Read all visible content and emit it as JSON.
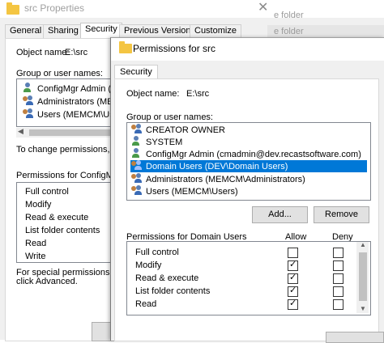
{
  "background_window": {
    "title": "src Properties",
    "tabs": [
      "General",
      "Sharing",
      "Security",
      "Previous Versions",
      "Customize"
    ],
    "active_tab": "Security",
    "object_name_label": "Object name:",
    "object_name_value": "E:\\src",
    "group_label": "Group or user names:",
    "users": [
      "ConfigMgr Admin (cm",
      "Administrators (MEMC",
      "Users (MEMCM\\Users"
    ],
    "change_text": "To change permissions, cl",
    "permissions_label": "Permissions for ConfigMgr",
    "permissions": [
      "Full control",
      "Modify",
      "Read & execute",
      "List folder contents",
      "Read",
      "Write"
    ],
    "special_line1": "For special permissions or",
    "special_line2": "click Advanced.",
    "right_strip_row1": "e folder",
    "right_strip_row2": "e folder"
  },
  "dialog": {
    "title": "Permissions for src",
    "tab": "Security",
    "object_name_label": "Object name:",
    "object_name_value": "E:\\src",
    "group_label": "Group or user names:",
    "users": [
      {
        "name": "CREATOR OWNER",
        "icon": "group-icon",
        "selected": false
      },
      {
        "name": "SYSTEM",
        "icon": "user-icon",
        "selected": false
      },
      {
        "name": "ConfigMgr Admin (cmadmin@dev.recastsoftware.com)",
        "icon": "user-icon",
        "selected": false
      },
      {
        "name": "Domain Users (DEV\\Domain Users)",
        "icon": "group-icon",
        "selected": true
      },
      {
        "name": "Administrators (MEMCM\\Administrators)",
        "icon": "group-icon",
        "selected": false
      },
      {
        "name": "Users (MEMCM\\Users)",
        "icon": "group-icon",
        "selected": false
      }
    ],
    "add_button": "Add...",
    "remove_button": "Remove",
    "permissions_label": "Permissions for Domain Users",
    "allow_label": "Allow",
    "deny_label": "Deny",
    "permissions": [
      {
        "name": "Full control",
        "allow": false,
        "deny": false
      },
      {
        "name": "Modify",
        "allow": true,
        "deny": false
      },
      {
        "name": "Read & execute",
        "allow": true,
        "deny": false
      },
      {
        "name": "List folder contents",
        "allow": true,
        "deny": false
      },
      {
        "name": "Read",
        "allow": true,
        "deny": false
      }
    ],
    "selection_color": "#0078d7"
  }
}
